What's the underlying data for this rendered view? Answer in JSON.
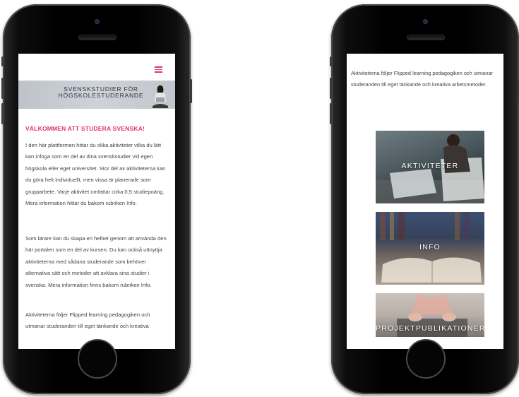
{
  "left_phone": {
    "banner_title_line1": "SVENSKSTUDIER FÖR",
    "banner_title_line2": "HÖGSKOLESTUDERANDE",
    "heading": "VÄLKOMMEN ATT STUDERA SVENSKA!",
    "paragraph1": "I den här plattformen hittar du olika aktiviteter vilka du lätt kan infoga som en del av dina svenskstudier vid egen högskola eller eget universitet. Stor del av aktiviteterna kan du göra helt individuellt, men vissa är planerade som grupparbete. Varje aktivitet omfattar cirka 0,5 studiepoäng. Mera information hittar du bakom rubriken Info.",
    "paragraph2": "Som lärare kan du skapa en helhet genom att använda den här portalen som en del av kursen. Du kan också uttnyttja aktiviteterna med sådana studerande som behöver alternativa sätt och metoder att avklara sina studier i svenska. Mera information finns bakom rubriken Info.",
    "paragraph3": "Aktiviteterna följer Flipped learning pedagogiken och utmanar studeranden till eget tänkande och kreativa"
  },
  "right_phone": {
    "intro": "Aktiviteterna följer Flipped learning pedagogiken och utmanar studeranden till eget tänkande och kreativa arbetsmetoder.",
    "tiles": [
      {
        "label": "AKTIVITETER"
      },
      {
        "label": "INFO"
      },
      {
        "label": "PROJEKTPUBLIKATIONER"
      }
    ]
  },
  "colors": {
    "accent": "#e3307a",
    "body_text": "#444444",
    "phone_body": "#000000"
  },
  "icons": [
    "menu-icon"
  ]
}
